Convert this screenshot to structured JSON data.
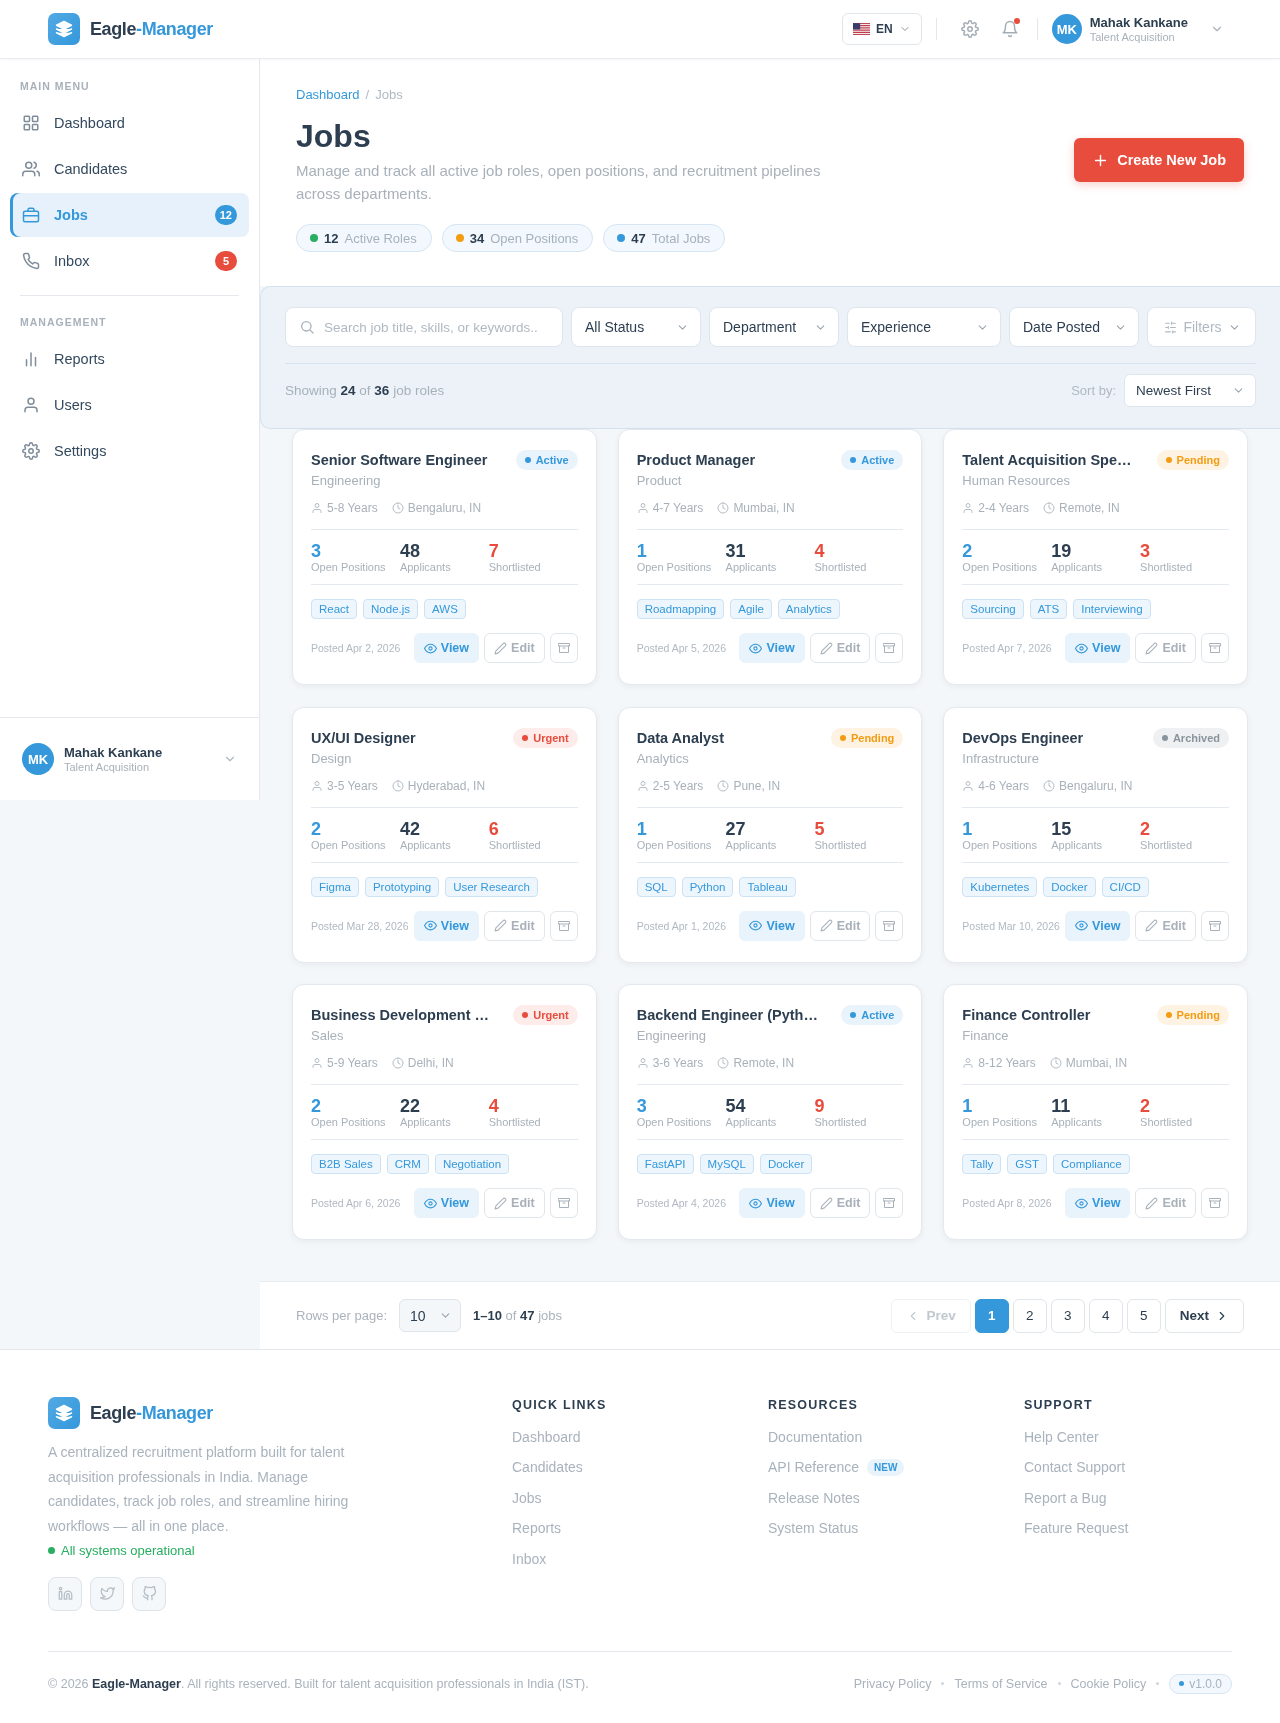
{
  "header": {
    "brand": {
      "name": "Eagle",
      "accent": "-Manager"
    },
    "language": "EN",
    "notifications": {
      "unread": true
    },
    "user": {
      "initials": "MK",
      "name": "Mahak Kankane",
      "role": "Talent Acquisition"
    }
  },
  "sidebar": {
    "sections": [
      {
        "title": "MAIN MENU",
        "items": [
          {
            "label": "Dashboard",
            "selected": false
          },
          {
            "label": "Candidates",
            "selected": false
          },
          {
            "label": "Jobs",
            "selected": true,
            "badge": {
              "text": "12",
              "color": "#3498db"
            }
          },
          {
            "label": "Inbox",
            "selected": false,
            "badge": {
              "text": "5",
              "color": "#e74c3c"
            }
          }
        ]
      },
      {
        "title": "MANAGEMENT",
        "items": [
          {
            "label": "Reports",
            "selected": false
          },
          {
            "label": "Users",
            "selected": false
          },
          {
            "label": "Settings",
            "selected": false
          }
        ]
      }
    ],
    "user": {
      "initials": "MK",
      "name": "Mahak Kankane",
      "role": "Talent Acquisition"
    }
  },
  "page_header": {
    "breadcrumb": [
      {
        "label": "Dashboard",
        "kind": "link"
      },
      {
        "label": "/",
        "kind": "separator"
      },
      {
        "label": "Jobs",
        "kind": "current"
      }
    ],
    "title": "Jobs",
    "description": "Manage and track all active job roles, open positions, and recruitment pipelines across departments.",
    "create_button": "Create New Job",
    "summary": [
      {
        "count": "12",
        "label": "Active Roles",
        "color": "#27ae60"
      },
      {
        "count": "34",
        "label": "Open Positions",
        "color": "#f39c12"
      },
      {
        "count": "47",
        "label": "Total Jobs",
        "color": "#3498db"
      }
    ]
  },
  "toolbar": {
    "search": {
      "placeholder": "Search job title, skills, or keywords.."
    },
    "filters": [
      {
        "value": "All Status"
      },
      {
        "value": "Department"
      },
      {
        "value": "Experience"
      },
      {
        "value": "Date Posted"
      }
    ],
    "more_filters": "Filters",
    "showing": "Showing **24** of **36** job roles",
    "sort": {
      "label": "Sort by:",
      "value": "Newest First"
    }
  },
  "jobs": [
    {
      "title": "Senior Software Engineer",
      "department": "Engineering",
      "status": {
        "label": "Active",
        "kind": "active"
      },
      "experience": "5-8 Years",
      "location": "Bengaluru, IN",
      "stats": [
        {
          "value": "3",
          "label": "Open Positions"
        },
        {
          "value": "48",
          "label": "Applicants"
        },
        {
          "value": "7",
          "label": "Shortlisted"
        }
      ],
      "tags": [
        "React",
        "Node.js",
        "AWS"
      ],
      "posted": "Posted Apr 2, 2026",
      "actions": {
        "view": "View",
        "edit": "Edit"
      }
    },
    {
      "title": "Product Manager",
      "department": "Product",
      "status": {
        "label": "Active",
        "kind": "active"
      },
      "experience": "4-7 Years",
      "location": "Mumbai, IN",
      "stats": [
        {
          "value": "1",
          "label": "Open Positions"
        },
        {
          "value": "31",
          "label": "Applicants"
        },
        {
          "value": "4",
          "label": "Shortlisted"
        }
      ],
      "tags": [
        "Roadmapping",
        "Agile",
        "Analytics"
      ],
      "posted": "Posted Apr 5, 2026",
      "actions": {
        "view": "View",
        "edit": "Edit"
      }
    },
    {
      "title": "Talent Acquisition Spe…",
      "department": "Human Resources",
      "status": {
        "label": "Pending",
        "kind": "pending"
      },
      "experience": "2-4 Years",
      "location": "Remote, IN",
      "stats": [
        {
          "value": "2",
          "label": "Open Positions"
        },
        {
          "value": "19",
          "label": "Applicants"
        },
        {
          "value": "3",
          "label": "Shortlisted"
        }
      ],
      "tags": [
        "Sourcing",
        "ATS",
        "Interviewing"
      ],
      "posted": "Posted Apr 7, 2026",
      "actions": {
        "view": "View",
        "edit": "Edit"
      }
    },
    {
      "title": "UX/UI Designer",
      "department": "Design",
      "status": {
        "label": "Urgent",
        "kind": "urgent"
      },
      "experience": "3-5 Years",
      "location": "Hyderabad, IN",
      "stats": [
        {
          "value": "2",
          "label": "Open Positions"
        },
        {
          "value": "42",
          "label": "Applicants"
        },
        {
          "value": "6",
          "label": "Shortlisted"
        }
      ],
      "tags": [
        "Figma",
        "Prototyping",
        "User Research"
      ],
      "posted": "Posted Mar 28, 2026",
      "actions": {
        "view": "View",
        "edit": "Edit"
      }
    },
    {
      "title": "Data Analyst",
      "department": "Analytics",
      "status": {
        "label": "Pending",
        "kind": "pending"
      },
      "experience": "2-5 Years",
      "location": "Pune, IN",
      "stats": [
        {
          "value": "1",
          "label": "Open Positions"
        },
        {
          "value": "27",
          "label": "Applicants"
        },
        {
          "value": "5",
          "label": "Shortlisted"
        }
      ],
      "tags": [
        "SQL",
        "Python",
        "Tableau"
      ],
      "posted": "Posted Apr 1, 2026",
      "actions": {
        "view": "View",
        "edit": "Edit"
      }
    },
    {
      "title": "DevOps Engineer",
      "department": "Infrastructure",
      "status": {
        "label": "Archived",
        "kind": "archived"
      },
      "experience": "4-6 Years",
      "location": "Bengaluru, IN",
      "stats": [
        {
          "value": "1",
          "label": "Open Positions"
        },
        {
          "value": "15",
          "label": "Applicants"
        },
        {
          "value": "2",
          "label": "Shortlisted"
        }
      ],
      "tags": [
        "Kubernetes",
        "Docker",
        "CI/CD"
      ],
      "posted": "Posted Mar 10, 2026",
      "actions": {
        "view": "View",
        "edit": "Edit"
      }
    },
    {
      "title": "Business Development …",
      "department": "Sales",
      "status": {
        "label": "Urgent",
        "kind": "urgent"
      },
      "experience": "5-9 Years",
      "location": "Delhi, IN",
      "stats": [
        {
          "value": "2",
          "label": "Open Positions"
        },
        {
          "value": "22",
          "label": "Applicants"
        },
        {
          "value": "4",
          "label": "Shortlisted"
        }
      ],
      "tags": [
        "B2B Sales",
        "CRM",
        "Negotiation"
      ],
      "posted": "Posted Apr 6, 2026",
      "actions": {
        "view": "View",
        "edit": "Edit"
      }
    },
    {
      "title": "Backend Engineer (Pyth…",
      "department": "Engineering",
      "status": {
        "label": "Active",
        "kind": "active"
      },
      "experience": "3-6 Years",
      "location": "Remote, IN",
      "stats": [
        {
          "value": "3",
          "label": "Open Positions"
        },
        {
          "value": "54",
          "label": "Applicants"
        },
        {
          "value": "9",
          "label": "Shortlisted"
        }
      ],
      "tags": [
        "FastAPI",
        "MySQL",
        "Docker"
      ],
      "posted": "Posted Apr 4, 2026",
      "actions": {
        "view": "View",
        "edit": "Edit"
      }
    },
    {
      "title": "Finance Controller",
      "department": "Finance",
      "status": {
        "label": "Pending",
        "kind": "pending"
      },
      "experience": "8-12 Years",
      "location": "Mumbai, IN",
      "stats": [
        {
          "value": "1",
          "label": "Open Positions"
        },
        {
          "value": "11",
          "label": "Applicants"
        },
        {
          "value": "2",
          "label": "Shortlisted"
        }
      ],
      "tags": [
        "Tally",
        "GST",
        "Compliance"
      ],
      "posted": "Posted Apr 8, 2026",
      "actions": {
        "view": "View",
        "edit": "Edit"
      }
    }
  ],
  "pagination": {
    "rows_label": "Rows per page:",
    "rows_value": "10",
    "range": "**1–10** of **47** jobs",
    "prev": {
      "label": "Prev",
      "disabled": true
    },
    "pages": [
      {
        "label": "1",
        "selected": true
      },
      {
        "label": "2",
        "selected": false
      },
      {
        "label": "3",
        "selected": false
      },
      {
        "label": "4",
        "selected": false
      },
      {
        "label": "5",
        "selected": false
      }
    ],
    "next": {
      "label": "Next",
      "disabled": false
    }
  },
  "footer": {
    "brand": {
      "name": "Eagle",
      "accent": "-Manager"
    },
    "description": "A centralized recruitment platform built for talent acquisition professionals in India. Manage candidates, track job roles, and streamline hiring workflows — all in one place.",
    "status": "All systems operational",
    "columns": [
      {
        "title": "QUICK LINKS",
        "links": [
          {
            "label": "Dashboard"
          },
          {
            "label": "Candidates"
          },
          {
            "label": "Jobs"
          },
          {
            "label": "Reports"
          },
          {
            "label": "Inbox"
          }
        ]
      },
      {
        "title": "RESOURCES",
        "links": [
          {
            "label": "Documentation"
          },
          {
            "label": "API Reference",
            "badge": "NEW"
          },
          {
            "label": "Release Notes"
          },
          {
            "label": "System Status"
          }
        ]
      },
      {
        "title": "SUPPORT",
        "links": [
          {
            "label": "Help Center"
          },
          {
            "label": "Contact Support"
          },
          {
            "label": "Report a Bug"
          },
          {
            "label": "Feature Request"
          }
        ]
      }
    ],
    "copyright": "© 2026 **Eagle-Manager**. All rights reserved. Built for talent acquisition professionals in India (IST).",
    "legal_links": [
      "Privacy Policy",
      "Terms of Service",
      "Cookie Policy"
    ],
    "version": "v1.0.0"
  }
}
